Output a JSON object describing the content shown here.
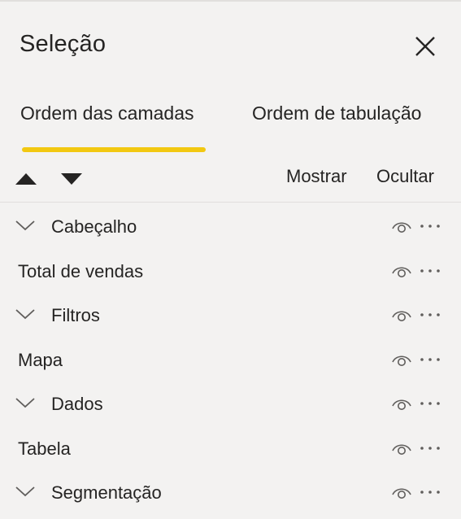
{
  "pane": {
    "title": "Seleção",
    "close_icon": "close-icon"
  },
  "tabs": [
    {
      "label": "Ordem das camadas",
      "active": true
    },
    {
      "label": "Ordem de tabulação",
      "active": false
    }
  ],
  "toolbar": {
    "move_up_icon": "triangle-up-icon",
    "move_down_icon": "triangle-down-icon",
    "show_label": "Mostrar",
    "hide_label": "Ocultar"
  },
  "layers": [
    {
      "label": "Cabeçalho",
      "is_group": true
    },
    {
      "label": "Total de vendas",
      "is_group": false
    },
    {
      "label": "Filtros",
      "is_group": true
    },
    {
      "label": "Mapa",
      "is_group": false
    },
    {
      "label": "Dados",
      "is_group": true
    },
    {
      "label": "Tabela",
      "is_group": false
    },
    {
      "label": "Segmentação",
      "is_group": true
    }
  ],
  "row_icons": {
    "expand": "chevron-down-icon",
    "visibility": "eye-icon",
    "more": "more-options-icon"
  },
  "colors": {
    "background": "#f3f2f1",
    "text": "#252423",
    "accent": "#f2c811",
    "icon": "#605e5c"
  }
}
